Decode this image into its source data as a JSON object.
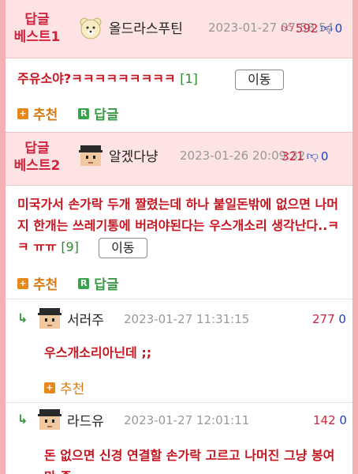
{
  "best1": {
    "label_line1": "답글",
    "label_line2": "베스트1",
    "username": "올드라스푸틴",
    "date": "2023-01-27 07:58:54",
    "likes": "592",
    "dislikes": "0",
    "content": "주유소야?ㅋㅋㅋㅋㅋㅋㅋㅋㅋ",
    "reply_count": "[1]",
    "move_label": "이동",
    "recommend_label": "추천",
    "reply_label": "답글",
    "recommend_icon": "plus-icon",
    "reply_icon": "r-icon"
  },
  "best2": {
    "label_line1": "답글",
    "label_line2": "베스트2",
    "username": "알겠다냥",
    "date": "2023-01-26 20:09:32",
    "likes": "321",
    "dislikes": "0",
    "content": "미국가서 손가락 두개 짤렸는데 하나 붙일돈밖에 없으면 나머지 한개는 쓰레기통에 버려야된다는 우스개소리 생각난다..ㅋㅋ ㅠㅠ",
    "reply_count": "[9]",
    "move_label": "이동",
    "recommend_label": "추천",
    "reply_label": "답글"
  },
  "replies": [
    {
      "username": "서러주",
      "date": "2023-01-27 11:31:15",
      "likes": "277",
      "dislikes": "0",
      "content": "우스개소리아닌데 ;;",
      "recommend_label": "추천"
    },
    {
      "username": "라드유",
      "date": "2023-01-27 12:01:11",
      "likes": "142",
      "dislikes": "0",
      "content": "돈 없으면 신경 연결할 손가락 고르고 나머진 그냥 봉여만 줌"
    }
  ],
  "colors": {
    "accent_red": "#d0233e",
    "best_bg": "#fde3e4",
    "recommend_orange": "#e8871a",
    "reply_green": "#38a34a",
    "dislike_blue": "#2340b6"
  }
}
